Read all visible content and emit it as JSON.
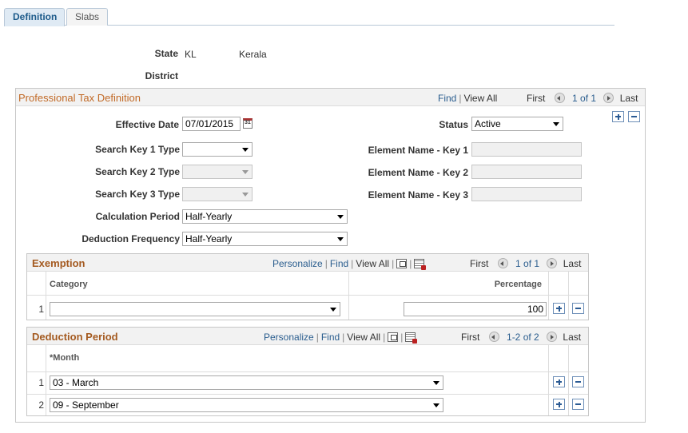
{
  "tabs": [
    {
      "label": "Definition",
      "active": true
    },
    {
      "label": "Slabs",
      "active": false
    }
  ],
  "header": {
    "state_label": "State",
    "state_code": "KL",
    "state_name": "Kerala",
    "district_label": "District"
  },
  "definition": {
    "title": "Professional Tax Definition",
    "find": "Find",
    "view_all": "View All",
    "first": "First",
    "count": "1 of 1",
    "last": "Last",
    "effective_date_label": "Effective Date",
    "effective_date": "07/01/2015",
    "status_label": "Status",
    "status": "Active",
    "search_key_1_label": "Search Key 1 Type",
    "search_key_2_label": "Search Key 2 Type",
    "search_key_3_label": "Search Key 3 Type",
    "element_key_1_label": "Element Name - Key 1",
    "element_key_2_label": "Element Name - Key 2",
    "element_key_3_label": "Element Name - Key 3",
    "calc_period_label": "Calculation Period",
    "calc_period": "Half-Yearly",
    "deduction_freq_label": "Deduction Frequency",
    "deduction_freq": "Half-Yearly"
  },
  "exemption": {
    "title": "Exemption",
    "personalize": "Personalize",
    "find": "Find",
    "view_all": "View All",
    "first": "First",
    "count": "1 of 1",
    "last": "Last",
    "col_category": "Category",
    "col_percentage": "Percentage",
    "rows": [
      {
        "num": "1",
        "category": "",
        "percentage": "100"
      }
    ]
  },
  "deduction_period": {
    "title": "Deduction Period",
    "personalize": "Personalize",
    "find": "Find",
    "view_all": "View All",
    "first": "First",
    "count": "1-2 of 2",
    "last": "Last",
    "col_month": "*Month",
    "rows": [
      {
        "num": "1",
        "month": "03 - March"
      },
      {
        "num": "2",
        "month": "09 - September"
      }
    ]
  }
}
